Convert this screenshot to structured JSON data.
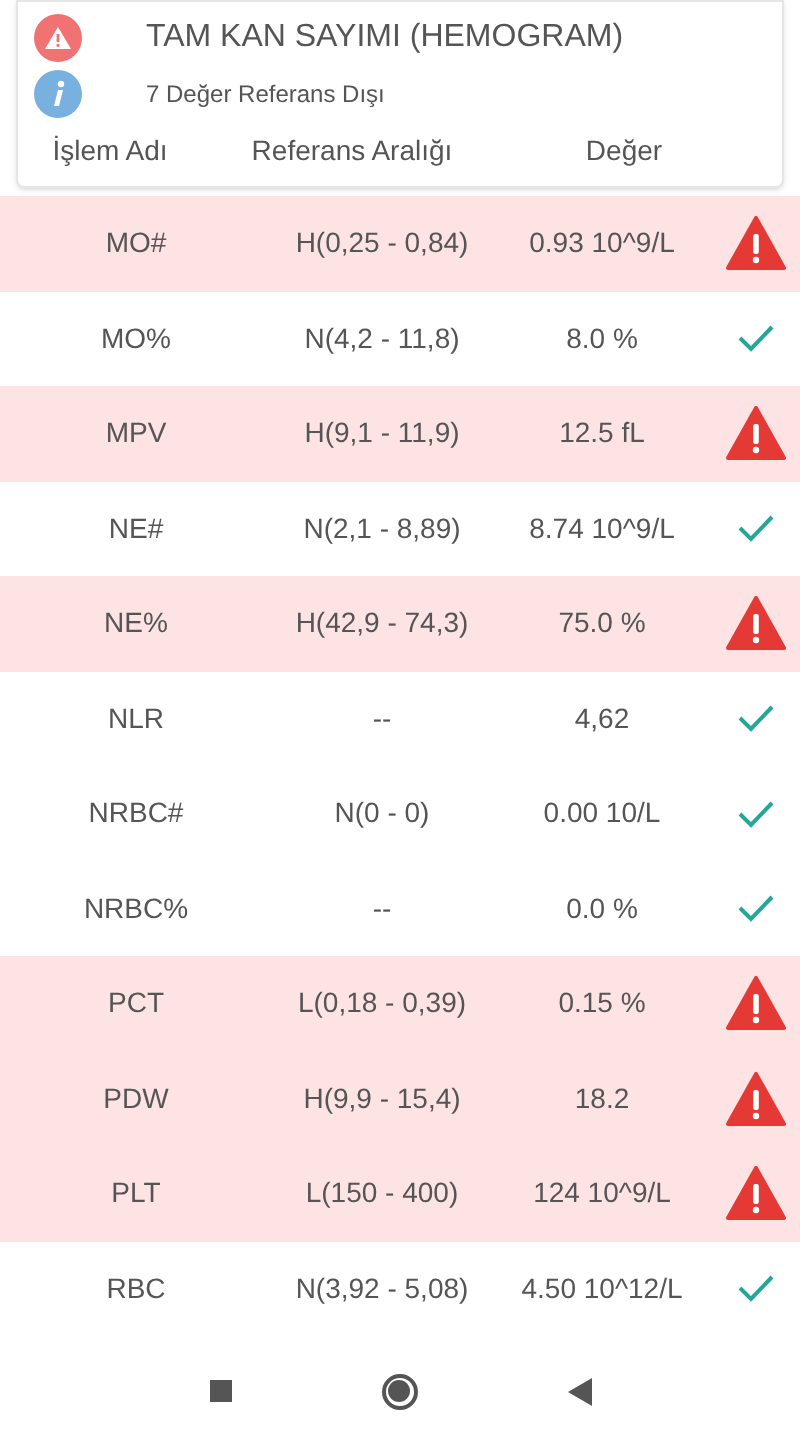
{
  "header": {
    "title": "TAM KAN SAYIMI (HEMOGRAM)",
    "subtitle": "7 Değer Referans Dışı"
  },
  "table": {
    "columns": [
      "İşlem Adı",
      "Referans Aralığı",
      "Değer"
    ],
    "rows": [
      {
        "name": "MO#",
        "range": "H(0,25 - 0,84)",
        "value": "0.93 10^9/L",
        "abnormal": true
      },
      {
        "name": "MO%",
        "range": "N(4,2 - 11,8)",
        "value": "8.0 %",
        "abnormal": false
      },
      {
        "name": "MPV",
        "range": "H(9,1 - 11,9)",
        "value": "12.5 fL",
        "abnormal": true
      },
      {
        "name": "NE#",
        "range": "N(2,1 - 8,89)",
        "value": "8.74 10^9/L",
        "abnormal": false
      },
      {
        "name": "NE%",
        "range": "H(42,9 - 74,3)",
        "value": "75.0 %",
        "abnormal": true
      },
      {
        "name": "NLR",
        "range": "--",
        "value": "4,62",
        "abnormal": false
      },
      {
        "name": "NRBC#",
        "range": "N(0 - 0)",
        "value": "0.00 10/L",
        "abnormal": false
      },
      {
        "name": "NRBC%",
        "range": "--",
        "value": "0.0 %",
        "abnormal": false
      },
      {
        "name": "PCT",
        "range": "L(0,18 - 0,39)",
        "value": "0.15 %",
        "abnormal": true
      },
      {
        "name": "PDW",
        "range": "H(9,9 - 15,4)",
        "value": "18.2",
        "abnormal": true
      },
      {
        "name": "PLT",
        "range": "L(150 - 400)",
        "value": "124 10^9/L",
        "abnormal": true
      },
      {
        "name": "RBC",
        "range": "N(3,92 - 5,08)",
        "value": "4.50 10^12/L",
        "abnormal": false
      }
    ]
  }
}
